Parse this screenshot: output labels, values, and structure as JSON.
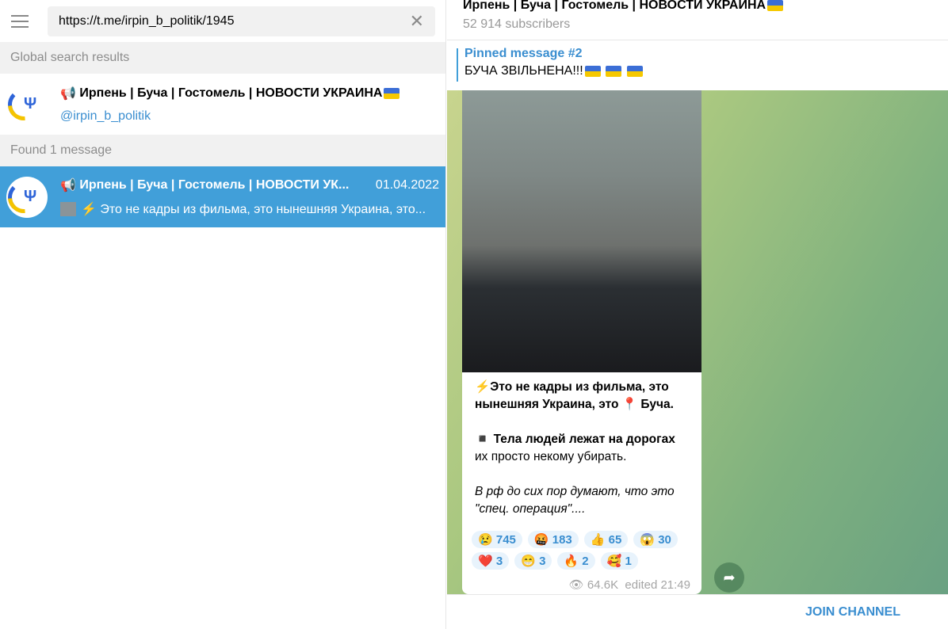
{
  "search": {
    "value": "https://t.me/irpin_b_politik/1945"
  },
  "sections": {
    "global": "Global search results",
    "found": "Found 1 message"
  },
  "channel_result": {
    "icon": "📢",
    "title": "Ирпень | Буча | Гостомель | НОВОСТИ УКРАИНА",
    "username": "@irpin_b_politik"
  },
  "message_result": {
    "icon": "📢",
    "title": "Ирпень | Буча | Гостомель | НОВОСТИ УК...",
    "date": "01.04.2022",
    "preview": "⚡ Это не кадры из фильма, это нынешняя Украина, это..."
  },
  "header": {
    "title": "Ирпень | Буча | Гостомель | НОВОСТИ УКРАИНА",
    "subscribers": "52 914 subscribers"
  },
  "pinned": {
    "title": "Pinned message #2",
    "text": "БУЧА ЗВІЛЬНЕНА!!!"
  },
  "message": {
    "line1": "⚡Это не кадры из фильма, это нынешняя Украина, это 📍 Буча.",
    "line2_bold": "◾ Тела людей лежат на дорогах",
    "line2": "их просто некому убирать.",
    "line3": "В рф до сих пор думают, что это \"спец. операция\"....",
    "reactions": [
      {
        "e": "😢",
        "n": "745"
      },
      {
        "e": "🤬",
        "n": "183"
      },
      {
        "e": "👍",
        "n": "65"
      },
      {
        "e": "😱",
        "n": "30"
      },
      {
        "e": "❤️",
        "n": "3"
      },
      {
        "e": "😁",
        "n": "3"
      },
      {
        "e": "🔥",
        "n": "2"
      },
      {
        "e": "🥰",
        "n": "1"
      }
    ],
    "views": "64.6K",
    "edited": "edited 21:49"
  },
  "join": "JOIN CHANNEL",
  "colors": {
    "accent": "#419fd9",
    "link": "#3a8ed0"
  }
}
